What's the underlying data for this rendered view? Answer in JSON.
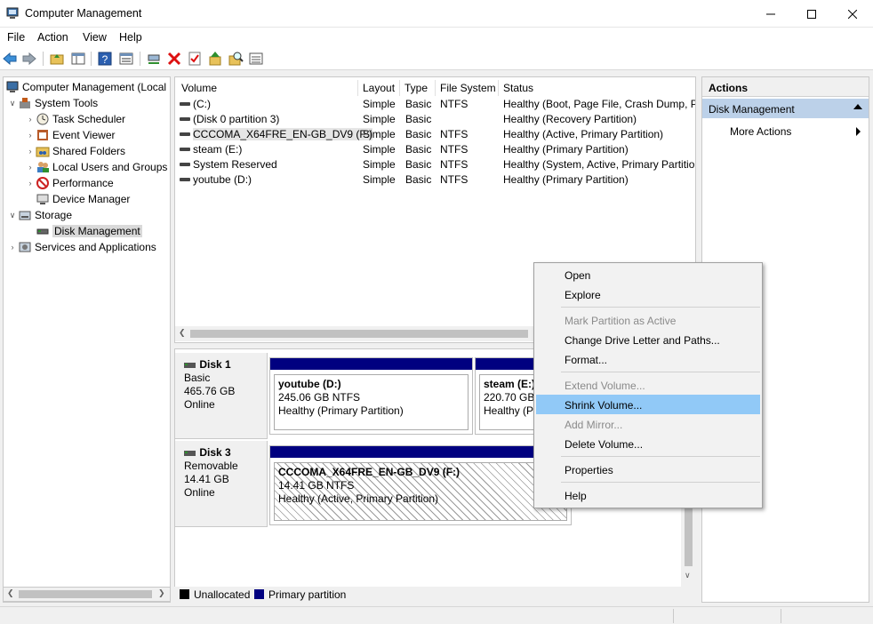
{
  "window": {
    "title": "Computer Management"
  },
  "menubar": [
    "File",
    "Action",
    "View",
    "Help"
  ],
  "tree": {
    "root": "Computer Management (Local",
    "items": [
      {
        "label": "System Tools",
        "icon": "tools-icon"
      },
      {
        "label": "Task Scheduler",
        "icon": "clock-icon"
      },
      {
        "label": "Event Viewer",
        "icon": "event-viewer-icon"
      },
      {
        "label": "Shared Folders",
        "icon": "shared-folder-icon"
      },
      {
        "label": "Local Users and Groups",
        "icon": "users-icon"
      },
      {
        "label": "Performance",
        "icon": "performance-icon"
      },
      {
        "label": "Device Manager",
        "icon": "device-manager-icon"
      },
      {
        "label": "Storage",
        "icon": "storage-icon"
      },
      {
        "label": "Disk Management",
        "icon": "disk-icon"
      },
      {
        "label": "Services and Applications",
        "icon": "services-icon"
      }
    ]
  },
  "volumes": {
    "columns": [
      "Volume",
      "Layout",
      "Type",
      "File System",
      "Status"
    ],
    "rows": [
      {
        "volume": "(C:)",
        "layout": "Simple",
        "type": "Basic",
        "fs": "NTFS",
        "status": "Healthy (Boot, Page File, Crash Dump, Pri"
      },
      {
        "volume": "(Disk 0 partition 3)",
        "layout": "Simple",
        "type": "Basic",
        "fs": "",
        "status": "Healthy (Recovery Partition)"
      },
      {
        "volume": "CCCOMA_X64FRE_EN-GB_DV9 (F:)",
        "layout": "Simple",
        "type": "Basic",
        "fs": "NTFS",
        "status": "Healthy (Active, Primary Partition)"
      },
      {
        "volume": "steam (E:)",
        "layout": "Simple",
        "type": "Basic",
        "fs": "NTFS",
        "status": "Healthy (Primary Partition)"
      },
      {
        "volume": "System Reserved",
        "layout": "Simple",
        "type": "Basic",
        "fs": "NTFS",
        "status": "Healthy (System, Active, Primary Partition"
      },
      {
        "volume": "youtube (D:)",
        "layout": "Simple",
        "type": "Basic",
        "fs": "NTFS",
        "status": "Healthy (Primary Partition)"
      }
    ]
  },
  "disks": [
    {
      "name": "Disk 1",
      "kind": "Basic",
      "size": "465.76 GB",
      "state": "Online",
      "partitions": [
        {
          "name": "youtube  (D:)",
          "size": "245.06 GB NTFS",
          "status": "Healthy (Primary Partition)"
        },
        {
          "name": "steam  (E:)",
          "size": "220.70 GB NT",
          "status": "Healthy (P"
        }
      ]
    },
    {
      "name": "Disk 3",
      "kind": "Removable",
      "size": "14.41 GB",
      "state": "Online",
      "partitions": [
        {
          "name": "CCCOMA_X64FRE_EN-GB_DV9  (F:)",
          "size": "14.41 GB NTFS",
          "status": "Healthy (Active, Primary Partition)"
        }
      ]
    }
  ],
  "legend": [
    {
      "label": "Unallocated",
      "color": "#000000"
    },
    {
      "label": "Primary partition",
      "color": "#000080"
    }
  ],
  "actions": {
    "header": "Actions",
    "group": "Disk Management",
    "more": "More Actions"
  },
  "context_menu": [
    {
      "label": "Open",
      "disabled": false
    },
    {
      "label": "Explore",
      "disabled": false
    },
    {
      "label": "Mark Partition as Active",
      "disabled": true
    },
    {
      "label": "Change Drive Letter and Paths...",
      "disabled": false
    },
    {
      "label": "Format...",
      "disabled": false
    },
    {
      "label": "Extend Volume...",
      "disabled": true
    },
    {
      "label": "Shrink Volume...",
      "disabled": false,
      "highlighted": true
    },
    {
      "label": "Add Mirror...",
      "disabled": true
    },
    {
      "label": "Delete Volume...",
      "disabled": false
    },
    {
      "label": "Properties",
      "disabled": false
    },
    {
      "label": "Help",
      "disabled": false
    }
  ],
  "colors": {
    "primary_partition": "#000080",
    "menu_highlight": "#91c9f7",
    "actions_group": "#bcd1e9"
  }
}
